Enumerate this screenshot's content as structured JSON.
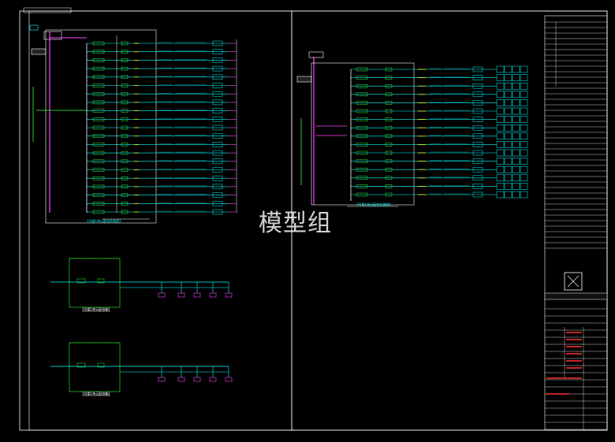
{
  "watermark": "模型组",
  "colors": {
    "background": "#000000",
    "border": "#ffffff",
    "cyan": "#00ffff",
    "green": "#33ff33",
    "magenta": "#ff44ff",
    "yellow": "#ffff00",
    "red": "#ff3333",
    "white": "#ffffff"
  },
  "panels": {
    "left_title": "1号楼1单元配电系统图1",
    "right_title": "1号楼1单元配电系统图2",
    "box1_title": "1号楼1单元配电箱1",
    "box2_title": "1号楼1单元配电箱2"
  },
  "title_block": {
    "design_label": "设 计 出 图 章",
    "seal_icon": "company-seal-icon",
    "drawing_name": "电气系统图"
  }
}
